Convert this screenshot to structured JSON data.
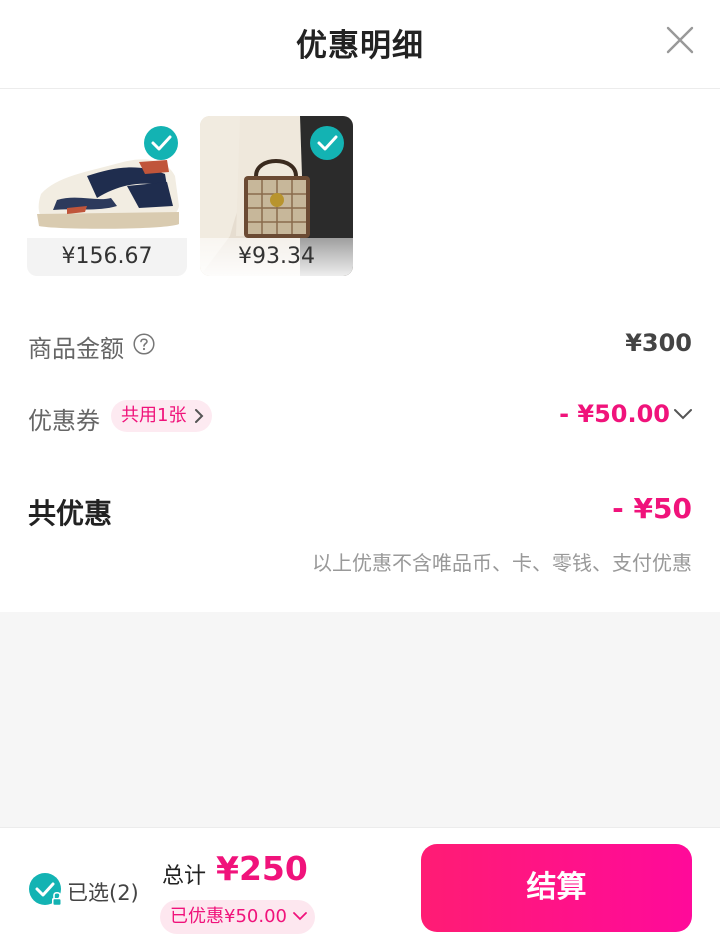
{
  "colors": {
    "accent": "#f0137b",
    "check": "#13b3b3",
    "button": "#ff1c74"
  },
  "header": {
    "title": "优惠明细",
    "close_icon": "close-icon"
  },
  "products": [
    {
      "name": "sneaker",
      "price": "¥156.67",
      "selected": true
    },
    {
      "name": "handbag",
      "price": "¥93.34",
      "selected": true
    }
  ],
  "details": {
    "goods_amount_label": "商品金额",
    "goods_amount_value": "¥300",
    "help_icon": "question-circle-icon",
    "coupon_label": "优惠券",
    "coupon_tag": "共用1张",
    "coupon_value": "- ¥50.00",
    "total_discount_label": "共优惠",
    "total_discount_value": "- ¥50",
    "note": "以上优惠不含唯品币、卡、零钱、支付优惠"
  },
  "footer": {
    "selected_text": "已选(2)",
    "total_label": "总计",
    "total_value": "¥250",
    "saved_text": "已优惠¥50.00",
    "checkout_label": "结算"
  }
}
